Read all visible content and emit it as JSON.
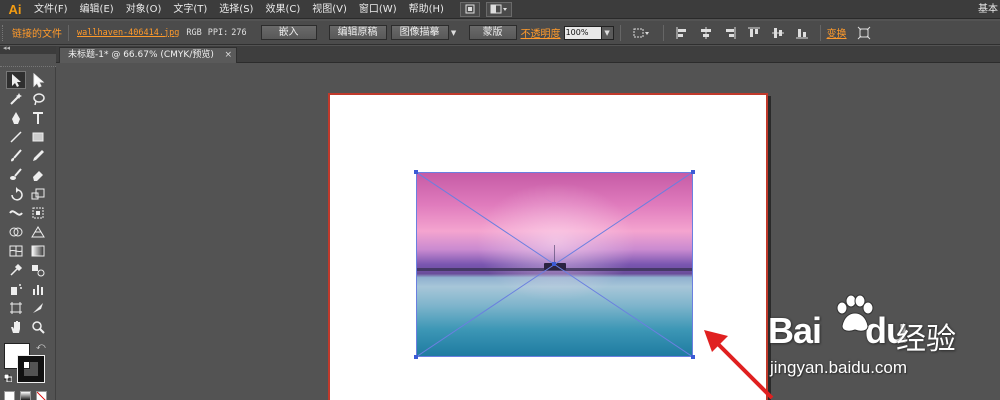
{
  "app": {
    "logo": "Ai",
    "workspace": "基本"
  },
  "menu": [
    "文件(F)",
    "编辑(E)",
    "对象(O)",
    "文字(T)",
    "选择(S)",
    "效果(C)",
    "视图(V)",
    "窗口(W)",
    "帮助(H)"
  ],
  "control_bar": {
    "linked_label": "链接的文件",
    "filename": "wallhaven-406414.jpg",
    "color_mode": "RGB",
    "ppi_label": "PPI:",
    "ppi_value": "276",
    "embed_button": "嵌入",
    "edit_original_button": "编辑原稿",
    "image_trace_button": "图像描摹",
    "mask_button": "蒙版",
    "opacity_label": "不透明度",
    "opacity_value": "100%",
    "transform_link": "变换"
  },
  "document": {
    "tab_title": "未标题-1* @ 66.67% (CMYK/预览)",
    "close_glyph": "×",
    "zoom": "66.67%"
  },
  "toolbox": {
    "collapse_glyph": "◂◂",
    "tools": [
      "selection-tool",
      "direct-selection-tool",
      "magic-wand-tool",
      "lasso-tool",
      "pen-tool",
      "type-tool",
      "line-tool",
      "rectangle-tool",
      "paintbrush-tool",
      "pencil-tool",
      "blob-brush-tool",
      "eraser-tool",
      "rotate-tool",
      "scale-tool",
      "width-tool",
      "free-transform-tool",
      "shape-builder-tool",
      "perspective-grid-tool",
      "mesh-tool",
      "gradient-tool",
      "eyedropper-tool",
      "blend-tool",
      "symbol-sprayer-tool",
      "column-graph-tool",
      "artboard-tool",
      "slice-tool",
      "hand-tool",
      "zoom-tool"
    ],
    "fill_color": "#ffffff",
    "stroke_color": "#111111"
  },
  "watermark": {
    "brand_left": "Bai",
    "brand_right": "du",
    "cn": "经验",
    "url": "jingyan.baidu.com"
  },
  "colors": {
    "accent": "#ff9a2b",
    "artboard_border": "#c0392b",
    "selection": "#3c5bd6",
    "arrow": "#e02020"
  }
}
